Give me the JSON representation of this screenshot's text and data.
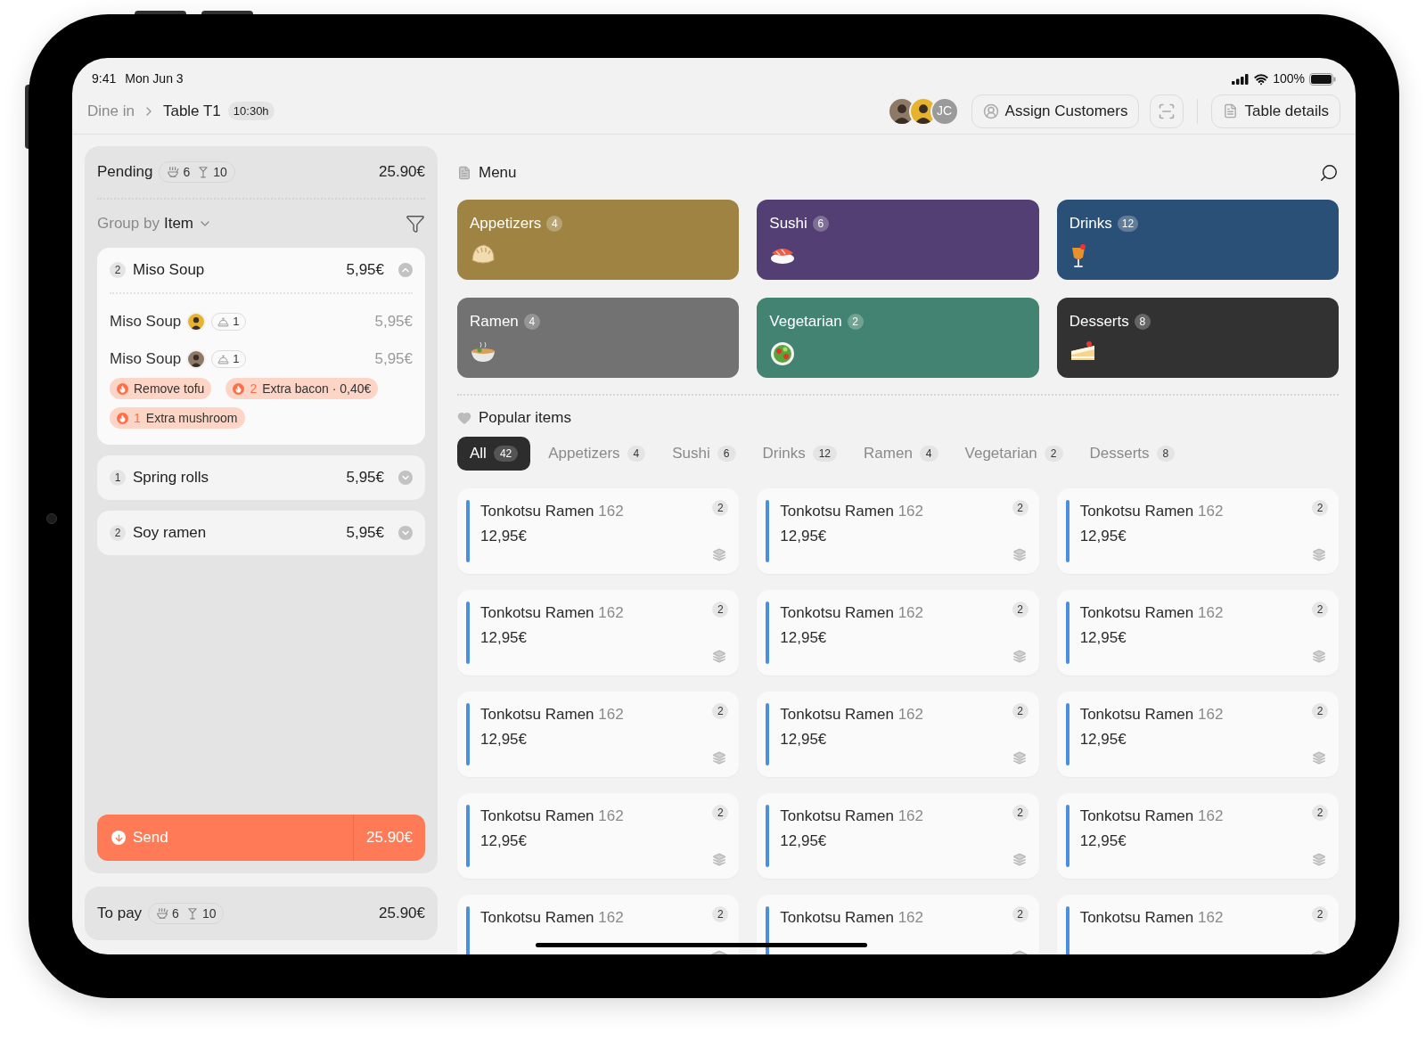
{
  "status_bar": {
    "time": "9:41",
    "date": "Mon Jun 3",
    "battery": "100%"
  },
  "header": {
    "breadcrumb": [
      "Dine in",
      "Table T1"
    ],
    "time_badge": "10:30h",
    "avatars": [
      {
        "kind": "photo"
      },
      {
        "kind": "photo"
      },
      {
        "kind": "initials",
        "initials": "JC"
      }
    ],
    "assign_button": "Assign Customers",
    "details_button": "Table details"
  },
  "order": {
    "pending": {
      "title": "Pending",
      "food_count": "6",
      "drink_count": "10",
      "total": "25.90€"
    },
    "group_by": {
      "label": "Group by",
      "value": "Item"
    },
    "groups": [
      {
        "qty": "2",
        "name": "Miso Soup",
        "price": "5,95€",
        "expanded": true,
        "lines": [
          {
            "name": "Miso Soup",
            "count": "1",
            "price": "5,95€"
          },
          {
            "name": "Miso Soup",
            "count": "1",
            "price": "5,95€",
            "modifiers": [
              {
                "label": "Remove tofu"
              },
              {
                "qty": "2",
                "label": "Extra bacon · 0,40€"
              },
              {
                "qty": "1",
                "label": "Extra mushroom"
              }
            ]
          }
        ]
      },
      {
        "qty": "1",
        "name": "Spring rolls",
        "price": "5,95€",
        "expanded": false
      },
      {
        "qty": "2",
        "name": "Soy ramen",
        "price": "5,95€",
        "expanded": false
      }
    ],
    "send": {
      "label": "Send",
      "total": "25.90€"
    },
    "to_pay": {
      "title": "To pay",
      "food_count": "6",
      "drink_count": "10",
      "total": "25.90€"
    }
  },
  "menu": {
    "title": "Menu",
    "categories": [
      {
        "name": "Appetizers",
        "count": "4",
        "color": "#9f8343"
      },
      {
        "name": "Sushi",
        "count": "6",
        "color": "#533f73"
      },
      {
        "name": "Drinks",
        "count": "12",
        "color": "#2b5077"
      },
      {
        "name": "Ramen",
        "count": "4",
        "color": "#727272"
      },
      {
        "name": "Vegetarian",
        "count": "2",
        "color": "#428371"
      },
      {
        "name": "Desserts",
        "count": "8",
        "color": "#323232"
      }
    ],
    "popular": {
      "title": "Popular items",
      "tabs": [
        {
          "label": "All",
          "count": "42",
          "selected": true
        },
        {
          "label": "Appetizers",
          "count": "4",
          "selected": false
        },
        {
          "label": "Sushi",
          "count": "6",
          "selected": false
        },
        {
          "label": "Drinks",
          "count": "12",
          "selected": false
        },
        {
          "label": "Ramen",
          "count": "4",
          "selected": false
        },
        {
          "label": "Vegetarian",
          "count": "2",
          "selected": false
        },
        {
          "label": "Desserts",
          "count": "8",
          "selected": false
        }
      ],
      "items": [
        {
          "name": "Tonkotsu Ramen",
          "code": "162",
          "price": "12,95€",
          "count": "2"
        },
        {
          "name": "Tonkotsu Ramen",
          "code": "162",
          "price": "12,95€",
          "count": "2"
        },
        {
          "name": "Tonkotsu Ramen",
          "code": "162",
          "price": "12,95€",
          "count": "2"
        },
        {
          "name": "Tonkotsu Ramen",
          "code": "162",
          "price": "12,95€",
          "count": "2"
        },
        {
          "name": "Tonkotsu Ramen",
          "code": "162",
          "price": "12,95€",
          "count": "2"
        },
        {
          "name": "Tonkotsu Ramen",
          "code": "162",
          "price": "12,95€",
          "count": "2"
        },
        {
          "name": "Tonkotsu Ramen",
          "code": "162",
          "price": "12,95€",
          "count": "2"
        },
        {
          "name": "Tonkotsu Ramen",
          "code": "162",
          "price": "12,95€",
          "count": "2"
        },
        {
          "name": "Tonkotsu Ramen",
          "code": "162",
          "price": "12,95€",
          "count": "2"
        },
        {
          "name": "Tonkotsu Ramen",
          "code": "162",
          "price": "12,95€",
          "count": "2"
        },
        {
          "name": "Tonkotsu Ramen",
          "code": "162",
          "price": "12,95€",
          "count": "2"
        },
        {
          "name": "Tonkotsu Ramen",
          "code": "162",
          "price": "12,95€",
          "count": "2"
        },
        {
          "name": "Tonkotsu Ramen",
          "code": "162",
          "count": "2"
        },
        {
          "name": "Tonkotsu Ramen",
          "code": "162",
          "count": "2"
        },
        {
          "name": "Tonkotsu Ramen",
          "code": "162",
          "count": "2"
        }
      ]
    }
  }
}
